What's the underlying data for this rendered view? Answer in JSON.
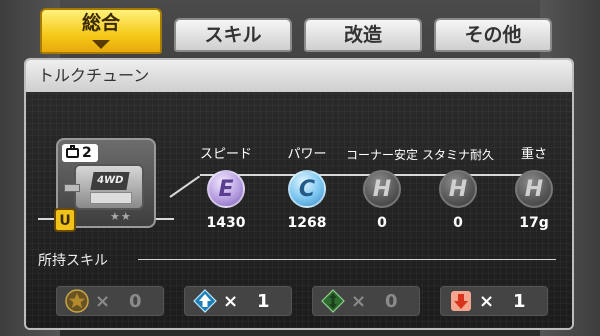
{
  "tabs": [
    {
      "label": "総合",
      "active": true
    },
    {
      "label": "スキル",
      "active": false
    },
    {
      "label": "改造",
      "active": false
    },
    {
      "label": "その他",
      "active": false
    }
  ],
  "panel": {
    "title": "トルクチューン",
    "part": {
      "level": "2",
      "motor_label": "4WD",
      "rank": "U",
      "stars": "★★"
    },
    "stats": [
      {
        "label": "スピード",
        "grade": "E",
        "value": "1430"
      },
      {
        "label": "パワー",
        "grade": "C",
        "value": "1268"
      },
      {
        "label": "コーナー安定",
        "grade": "H",
        "value": "0"
      },
      {
        "label": "スタミナ耐久",
        "grade": "H",
        "value": "0"
      },
      {
        "label": "重さ",
        "grade": "H",
        "value": "17g"
      }
    ],
    "skills": {
      "heading": "所持スキル",
      "items": [
        {
          "icon": "star-icon",
          "x": "×",
          "count": "0",
          "active": false
        },
        {
          "icon": "up-arrow-icon",
          "x": "×",
          "count": "1",
          "active": true
        },
        {
          "icon": "up-down-arrow-icon",
          "x": "×",
          "count": "0",
          "active": false
        },
        {
          "icon": "down-arrow-icon",
          "x": "×",
          "count": "1",
          "active": true
        }
      ]
    }
  },
  "colors": {
    "tab_active": "#f6c919",
    "grade_E": "#b79fe0",
    "grade_C": "#79c5ef",
    "grade_H": "#555555",
    "up_icon": "#3fb6e6",
    "down_icon": "#e0442c",
    "updown_icon": "#3a8a3a",
    "star_icon": "#b38a2c"
  }
}
